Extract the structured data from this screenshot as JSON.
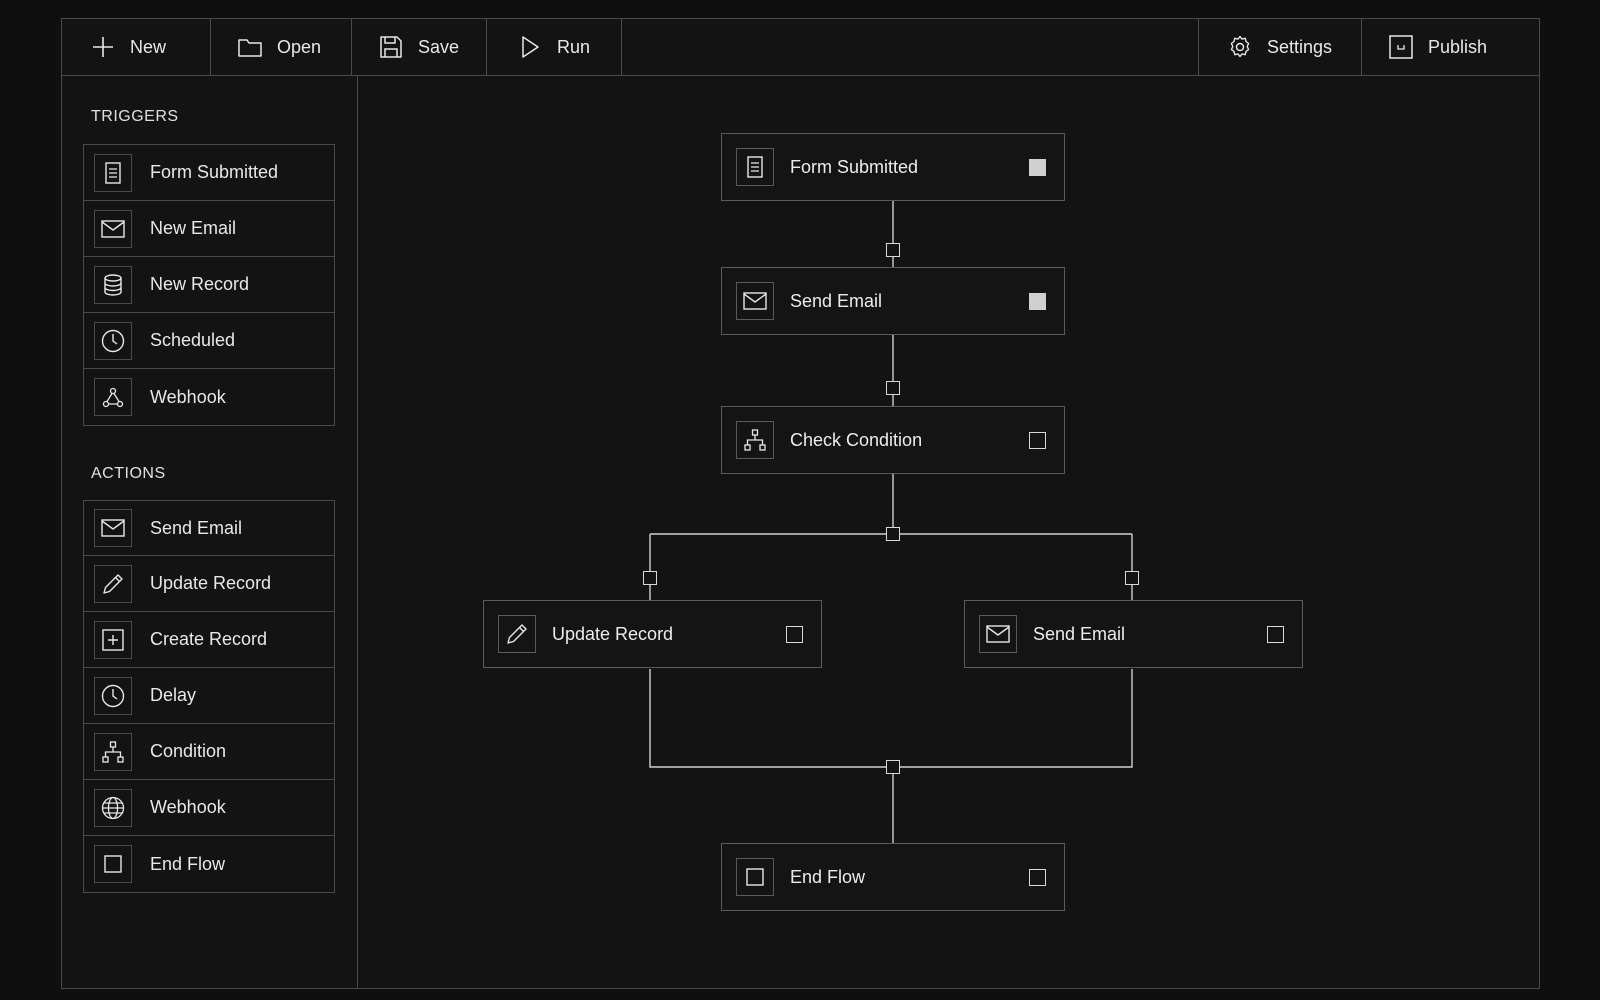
{
  "toolbar": {
    "new_label": "New",
    "open_label": "Open",
    "save_label": "Save",
    "run_label": "Run",
    "settings_label": "Settings",
    "publish_label": "Publish"
  },
  "sidebar": {
    "triggers_title": "TRIGGERS",
    "triggers": [
      {
        "label": "Form Submitted",
        "icon": "form-icon"
      },
      {
        "label": "New Email",
        "icon": "mail-icon"
      },
      {
        "label": "New Record",
        "icon": "database-icon"
      },
      {
        "label": "Scheduled",
        "icon": "clock-icon"
      },
      {
        "label": "Webhook",
        "icon": "webhook-icon"
      }
    ],
    "actions_title": "ACTIONS",
    "actions": [
      {
        "label": "Send Email",
        "icon": "mail-icon"
      },
      {
        "label": "Update Record",
        "icon": "pencil-icon"
      },
      {
        "label": "Create Record",
        "icon": "plus-box-icon"
      },
      {
        "label": "Delay",
        "icon": "clock-icon"
      },
      {
        "label": "Condition",
        "icon": "branch-icon"
      },
      {
        "label": "Webhook",
        "icon": "globe-icon"
      },
      {
        "label": "End Flow",
        "icon": "stop-icon"
      }
    ]
  },
  "flow": {
    "nodes": [
      {
        "label": "Form Submitted",
        "icon": "form-icon",
        "checked": true
      },
      {
        "label": "Send Email",
        "icon": "mail-icon",
        "checked": true
      },
      {
        "label": "Check Condition",
        "icon": "branch-icon",
        "checked": false
      },
      {
        "label": "Update Record",
        "icon": "pencil-icon",
        "checked": false
      },
      {
        "label": "Send Email",
        "icon": "mail-icon",
        "checked": false
      },
      {
        "label": "End Flow",
        "icon": "stop-icon",
        "checked": false
      }
    ]
  },
  "colors": {
    "background": "#0f0f0f",
    "panel": "#131313",
    "border": "#4a4a4a",
    "text": "#e8e8e8",
    "wire": "#cfcfcf"
  }
}
